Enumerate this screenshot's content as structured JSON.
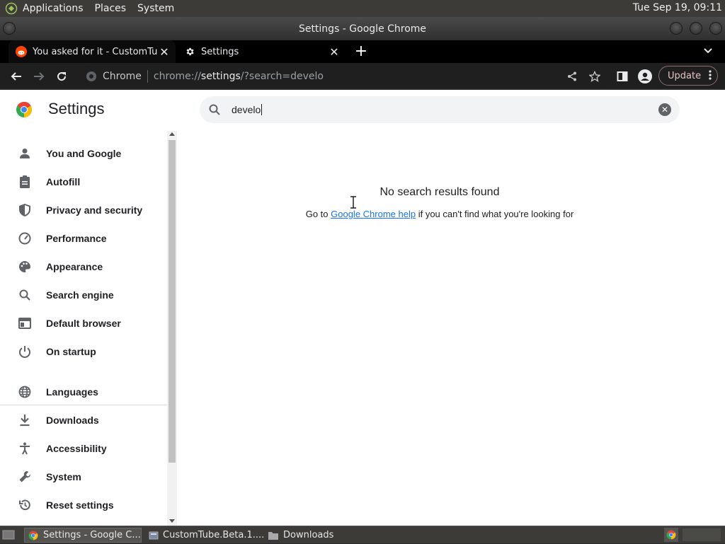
{
  "top_panel": {
    "menus": [
      "Applications",
      "Places",
      "System"
    ],
    "clock": "Tue Sep 19, 09:11"
  },
  "window": {
    "title": "Settings - Google Chrome"
  },
  "tabs": [
    {
      "title": "You asked for it - CustomTube",
      "icon": "reddit-icon"
    },
    {
      "title": "Settings",
      "icon": "gear-icon"
    }
  ],
  "toolbar": {
    "chip": "Chrome",
    "url_prefix": "chrome://",
    "url_main": "settings",
    "url_suffix": "/?search=develo",
    "update_label": "Update"
  },
  "settings": {
    "title": "Settings",
    "search_value": "develo",
    "nav": [
      {
        "label": "You and Google",
        "icon": "person-icon"
      },
      {
        "label": "Autofill",
        "icon": "clipboard-icon"
      },
      {
        "label": "Privacy and security",
        "icon": "shield-icon"
      },
      {
        "label": "Performance",
        "icon": "speedometer-icon"
      },
      {
        "label": "Appearance",
        "icon": "palette-icon"
      },
      {
        "label": "Search engine",
        "icon": "search-icon"
      },
      {
        "label": "Default browser",
        "icon": "browser-icon"
      },
      {
        "label": "On startup",
        "icon": "power-icon"
      },
      {
        "label": "Languages",
        "icon": "globe-icon"
      },
      {
        "label": "Downloads",
        "icon": "download-icon"
      },
      {
        "label": "Accessibility",
        "icon": "accessibility-icon"
      },
      {
        "label": "System",
        "icon": "wrench-icon"
      },
      {
        "label": "Reset settings",
        "icon": "reset-icon"
      }
    ],
    "no_results_title": "No search results found",
    "help_prefix": "Go to ",
    "help_link": "Google Chrome help",
    "help_suffix": " if you can't find what you're looking for"
  },
  "taskbar": {
    "items": [
      {
        "label": "Settings - Google C...",
        "icon": "chrome-icon"
      },
      {
        "label": "CustomTube.Beta.1....",
        "icon": "file-icon"
      },
      {
        "label": "Downloads",
        "icon": "folder-icon"
      }
    ]
  },
  "colors": {
    "link": "#1a73e8",
    "panel": "#3c3b37",
    "toolbar": "#1f1f1f"
  }
}
